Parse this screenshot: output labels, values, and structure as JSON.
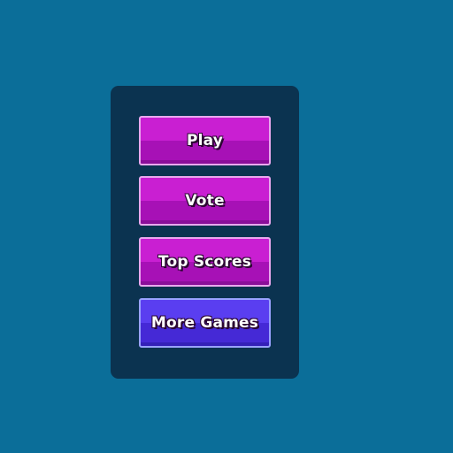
{
  "colors": {
    "background": "#0b6e99",
    "panel": "#0b3350",
    "button_primary": "#c91fd2",
    "button_secondary": "#5a3ef0",
    "button_text": "#ffffff"
  },
  "menu": {
    "buttons": [
      {
        "label": "Play"
      },
      {
        "label": "Vote"
      },
      {
        "label": "Top Scores"
      },
      {
        "label": "More Games"
      }
    ]
  }
}
